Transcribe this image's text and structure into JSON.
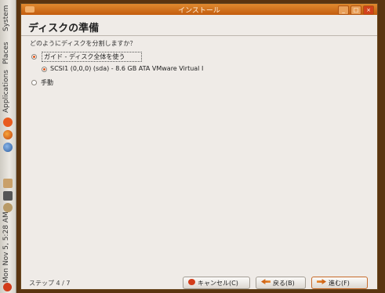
{
  "panel": {
    "places": "Places",
    "system": "System",
    "applications": "Applications",
    "clock": "Mon Nov  5,  5:28 AM"
  },
  "window": {
    "title": "インストール",
    "heading": "ディスクの準備",
    "question": "どのようにディスクを分割しますか？",
    "option_guided": "ガイド - ディスク全体を使う",
    "option_disk": "SCSI1 (0,0,0) (sda) - 8.6 GB ATA VMware Virtual I",
    "option_manual": "手動",
    "step": "ステップ 4 / 7",
    "cancel_button": "キャンセル(C)",
    "back_button": "戻る(B)",
    "forward_button": "進む(F)"
  },
  "colors": {
    "accent": "#e0561a",
    "titlebar": "#d9771f",
    "desktop": "#5a3410"
  }
}
